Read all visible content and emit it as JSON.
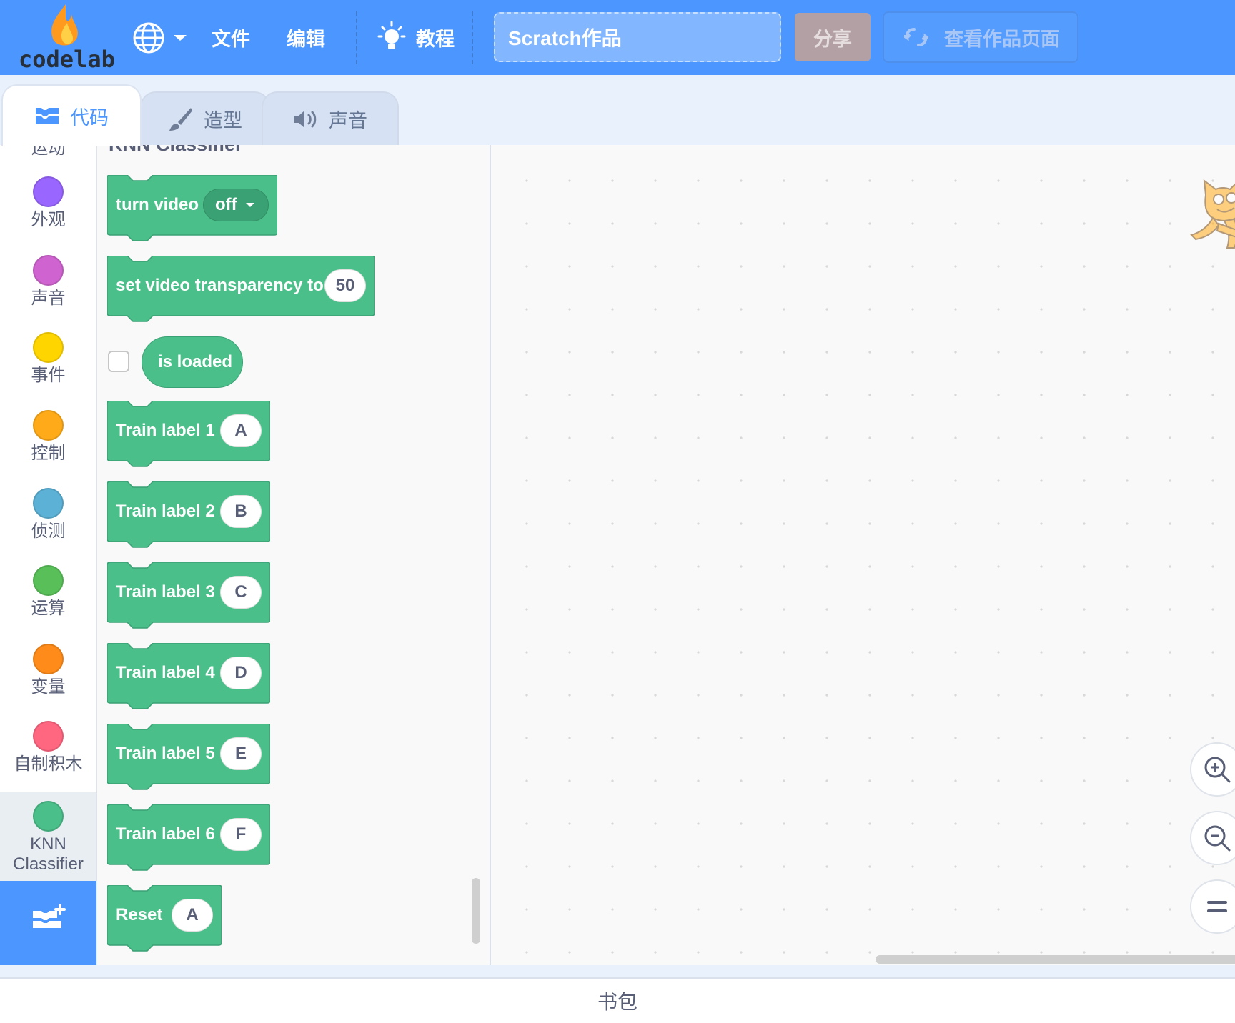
{
  "menubar": {
    "logo_text": "codelab",
    "file": "文件",
    "edit": "编辑",
    "tutorials": "教程",
    "project_title": "Scratch作品",
    "share": "分享",
    "see_project_page": "查看作品页面"
  },
  "tabs": {
    "code": "代码",
    "costumes": "造型",
    "sounds": "声音"
  },
  "categories": [
    {
      "label": "运动",
      "color": "#4c97ff"
    },
    {
      "label": "外观",
      "color": "#9966ff"
    },
    {
      "label": "声音",
      "color": "#cf63cf"
    },
    {
      "label": "事件",
      "color": "#ffd500"
    },
    {
      "label": "控制",
      "color": "#ffab19"
    },
    {
      "label": "侦测",
      "color": "#5cb1d6"
    },
    {
      "label": "运算",
      "color": "#59c059"
    },
    {
      "label": "变量",
      "color": "#ff8c1a"
    },
    {
      "label": "自制积木",
      "color": "#ff6680"
    },
    {
      "label": "KNN Classifier",
      "color": "#4bbf8a"
    }
  ],
  "palette": {
    "heading": "KNN Classifier",
    "blocks": {
      "turn_video": {
        "label": "turn video",
        "value": "off"
      },
      "set_transparency": {
        "label": "set video transparency to",
        "value": "50"
      },
      "is_loaded": {
        "label": "is loaded"
      },
      "train1": {
        "label": "Train label 1",
        "value": "A"
      },
      "train2": {
        "label": "Train label 2",
        "value": "B"
      },
      "train3": {
        "label": "Train label 3",
        "value": "C"
      },
      "train4": {
        "label": "Train label 4",
        "value": "D"
      },
      "train5": {
        "label": "Train label 5",
        "value": "E"
      },
      "train6": {
        "label": "Train label 6",
        "value": "F"
      },
      "reset": {
        "label": "Reset",
        "value": "A"
      }
    }
  },
  "colors": {
    "accent": "#4c97ff",
    "extension_block": "#4bbf8a",
    "extension_block_dark": "#3aa174"
  },
  "footer": {
    "backpack": "书包"
  }
}
